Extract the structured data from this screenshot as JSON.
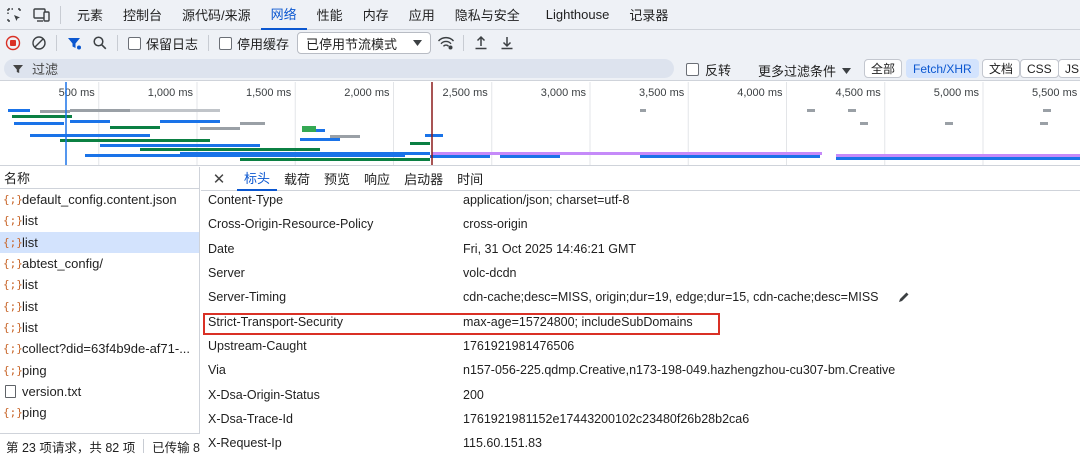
{
  "main_tabs": [
    "元素",
    "控制台",
    "源代码/来源",
    "网络",
    "性能",
    "内存",
    "应用",
    "隐私与安全",
    "Lighthouse",
    "记录器"
  ],
  "active_main_tab": "网络",
  "toolbar": {
    "preserve_log": "保留日志",
    "disable_cache": "停用缓存",
    "throttle_select": "已停用节流模式"
  },
  "filter": {
    "placeholder": "过滤",
    "invert": "反转",
    "more_filters": "更多过滤条件",
    "type_buttons": [
      "全部",
      "Fetch/XHR",
      "文档",
      "CSS",
      "JS"
    ],
    "active_type": "Fetch/XHR"
  },
  "overview": {
    "tick_labels": [
      "500 ms",
      "1,000 ms",
      "1,500 ms",
      "2,000 ms",
      "2,500 ms",
      "3,000 ms",
      "3,500 ms",
      "4,000 ms",
      "4,500 ms",
      "5,000 ms",
      "5,500 ms"
    ]
  },
  "requests": {
    "column_name": "名称",
    "items": [
      {
        "name": "default_config.content.json",
        "icon": "xhr-icon",
        "selected": false
      },
      {
        "name": "list",
        "icon": "xhr-icon",
        "selected": false
      },
      {
        "name": "list",
        "icon": "xhr-icon",
        "selected": true
      },
      {
        "name": "abtest_config/",
        "icon": "xhr-icon",
        "selected": false
      },
      {
        "name": "list",
        "icon": "xhr-icon",
        "selected": false
      },
      {
        "name": "list",
        "icon": "xhr-icon",
        "selected": false
      },
      {
        "name": "list",
        "icon": "xhr-icon",
        "selected": false
      },
      {
        "name": "collect?did=63f4b9de-af71-...",
        "icon": "xhr-icon",
        "selected": false
      },
      {
        "name": "ping",
        "icon": "xhr-icon",
        "selected": false
      },
      {
        "name": "version.txt",
        "icon": "document-icon",
        "selected": false
      },
      {
        "name": "ping",
        "icon": "xhr-icon",
        "selected": false
      }
    ]
  },
  "status": {
    "requests": "第 23 项请求，共 82 项",
    "transferred": "已传输 8"
  },
  "detail_tabs": [
    "标头",
    "载荷",
    "预览",
    "响应",
    "启动器",
    "时间"
  ],
  "active_detail_tab": "标头",
  "headers": [
    {
      "name": "Content-Type",
      "value": "application/json; charset=utf-8"
    },
    {
      "name": "Cross-Origin-Resource-Policy",
      "value": "cross-origin"
    },
    {
      "name": "Date",
      "value": "Fri, 31 Oct 2025 14:46:21 GMT"
    },
    {
      "name": "Server",
      "value": "volc-dcdn"
    },
    {
      "name": "Server-Timing",
      "value": "cdn-cache;desc=MISS, origin;dur=19, edge;dur=15, cdn-cache;desc=MISS"
    },
    {
      "name": "Strict-Transport-Security",
      "value": "max-age=15724800; includeSubDomains"
    },
    {
      "name": "Upstream-Caught",
      "value": "1761921981476506"
    },
    {
      "name": "Via",
      "value": "n157-056-225.qdmp.Creative,n173-198-049.hazhengzhou-cu307-bm.Creative"
    },
    {
      "name": "X-Dsa-Origin-Status",
      "value": "200"
    },
    {
      "name": "X-Dsa-Trace-Id",
      "value": "1761921981152e17443200102c23480f26b28b2ca6"
    },
    {
      "name": "X-Request-Ip",
      "value": "115.60.151.83"
    }
  ],
  "colors": {
    "accent": "#0b57d0",
    "highlight_border": "#d93025",
    "record_red": "#d93025"
  }
}
